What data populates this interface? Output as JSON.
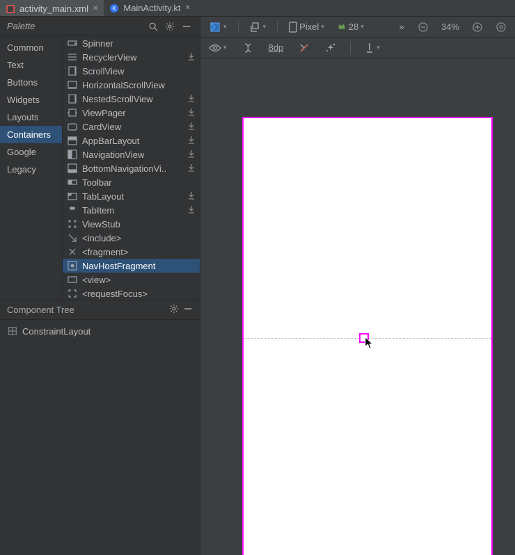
{
  "tabs": [
    {
      "label": "activity_main.xml",
      "active": true
    },
    {
      "label": "MainActivity.kt",
      "active": false
    }
  ],
  "palette": {
    "title": "Palette",
    "categories": [
      "Common",
      "Text",
      "Buttons",
      "Widgets",
      "Layouts",
      "Containers",
      "Google",
      "Legacy"
    ],
    "selected_category": "Containers",
    "widgets": [
      {
        "name": "Spinner",
        "icon": "spinner",
        "dl": false
      },
      {
        "name": "RecyclerView",
        "icon": "list",
        "dl": true
      },
      {
        "name": "ScrollView",
        "icon": "scroll-v",
        "dl": false
      },
      {
        "name": "HorizontalScrollView",
        "icon": "scroll-h",
        "dl": false
      },
      {
        "name": "NestedScrollView",
        "icon": "scroll-v",
        "dl": true
      },
      {
        "name": "ViewPager",
        "icon": "pager",
        "dl": true
      },
      {
        "name": "CardView",
        "icon": "card",
        "dl": true
      },
      {
        "name": "AppBarLayout",
        "icon": "appbar",
        "dl": true
      },
      {
        "name": "NavigationView",
        "icon": "nav",
        "dl": true
      },
      {
        "name": "BottomNavigationVi..",
        "icon": "bottomnav",
        "dl": true
      },
      {
        "name": "Toolbar",
        "icon": "toolbar",
        "dl": false
      },
      {
        "name": "TabLayout",
        "icon": "tabs",
        "dl": true
      },
      {
        "name": "TabItem",
        "icon": "tabitem",
        "dl": true
      },
      {
        "name": "ViewStub",
        "icon": "stub",
        "dl": false
      },
      {
        "name": "<include>",
        "icon": "include",
        "dl": false
      },
      {
        "name": "<fragment>",
        "icon": "fragment",
        "dl": false
      },
      {
        "name": "NavHostFragment",
        "icon": "navhost",
        "dl": false,
        "selected": true
      },
      {
        "name": "<view>",
        "icon": "view",
        "dl": false
      },
      {
        "name": "<requestFocus>",
        "icon": "focus",
        "dl": false
      }
    ]
  },
  "component_tree": {
    "title": "Component Tree",
    "root": "ConstraintLayout"
  },
  "design_toolbar": {
    "device": "Pixel",
    "api": "28",
    "zoom": "34%",
    "spacing": "8dp"
  }
}
